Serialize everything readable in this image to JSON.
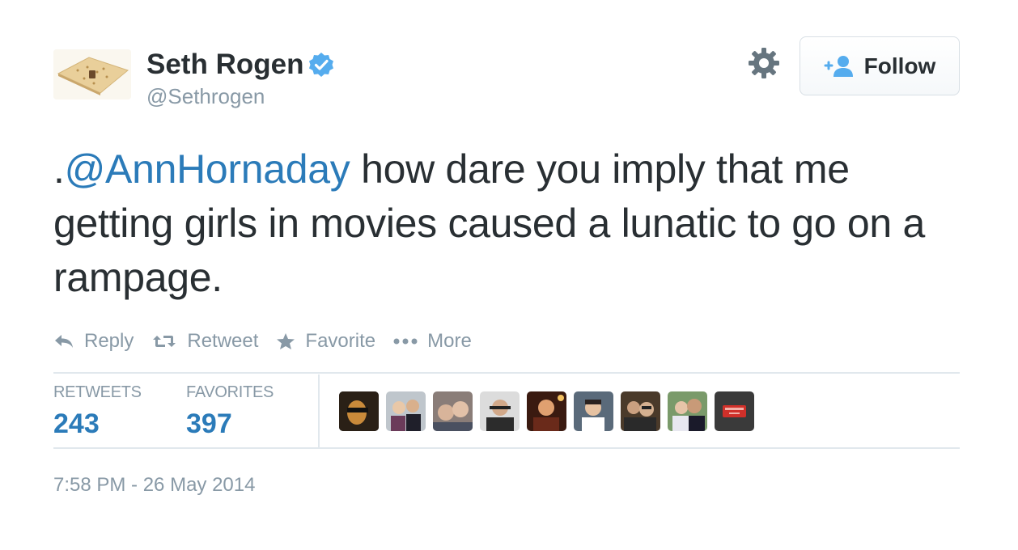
{
  "author": {
    "name": "Seth Rogen",
    "handle": "@Sethrogen",
    "verified": true
  },
  "follow_button": {
    "label": "Follow"
  },
  "tweet": {
    "prefix": ".",
    "mention": "@AnnHornaday",
    "body": " how dare you imply that me getting girls in movies caused a lunatic to go on a rampage."
  },
  "actions": [
    {
      "label": "Reply",
      "icon": "reply-icon"
    },
    {
      "label": "Retweet",
      "icon": "retweet-icon"
    },
    {
      "label": "Favorite",
      "icon": "star-icon"
    },
    {
      "label": "More",
      "icon": "more-dots-icon"
    }
  ],
  "stats": {
    "retweets_label": "RETWEETS",
    "retweets_value": "243",
    "favorites_label": "FAVORITES",
    "favorites_value": "397"
  },
  "timestamp": "7:58 PM - 26 May 2014",
  "colors": {
    "link": "#2b7bb9",
    "muted": "#8899a6",
    "text": "#292f33",
    "verified": "#55acee"
  }
}
